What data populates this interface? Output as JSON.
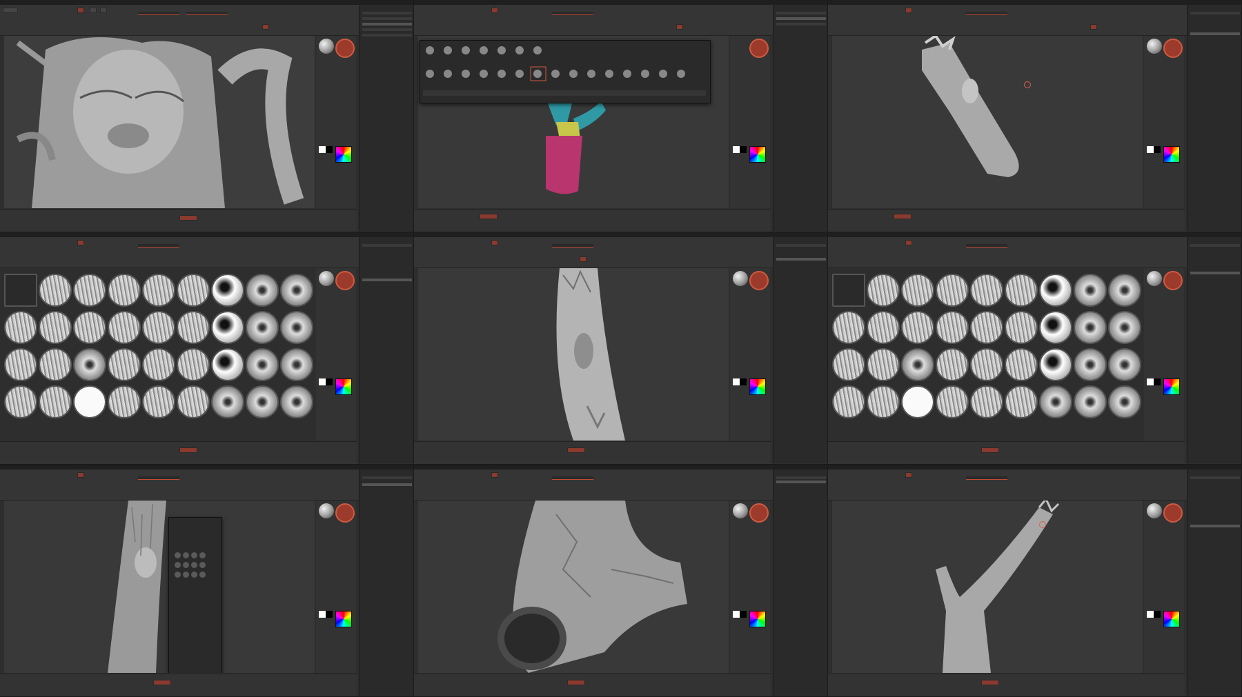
{
  "tiles": [
    {
      "id": "tile-1",
      "content": "yoda-sculpt",
      "view": "3d-viewport"
    },
    {
      "id": "tile-2",
      "content": "branch-polygroups",
      "view": "brush-popup"
    },
    {
      "id": "tile-3",
      "content": "branch-smooth",
      "view": "3d-viewport"
    },
    {
      "id": "tile-4",
      "content": "alpha-library",
      "view": "alpha-grid"
    },
    {
      "id": "tile-5",
      "content": "trunk-closeup",
      "view": "3d-viewport"
    },
    {
      "id": "tile-6",
      "content": "alpha-library",
      "view": "alpha-grid"
    },
    {
      "id": "tile-7",
      "content": "trunk-brush-picker",
      "view": "3d-viewport"
    },
    {
      "id": "tile-8",
      "content": "bark-sculpt",
      "view": "3d-viewport"
    },
    {
      "id": "tile-9",
      "content": "branch-fork",
      "view": "3d-viewport"
    }
  ],
  "colors": {
    "background": "#2b2b2b",
    "accent": "#c24a33",
    "active_color": "#9c3a2b",
    "polygroup_teal": "#2f9aa6",
    "polygroup_magenta": "#b8356e",
    "polygroup_yellow": "#c8c64a"
  },
  "icons": [
    "matcap-sphere-icon",
    "color-circle-icon",
    "color-picker-icon",
    "brush-icon",
    "alpha-icon"
  ]
}
